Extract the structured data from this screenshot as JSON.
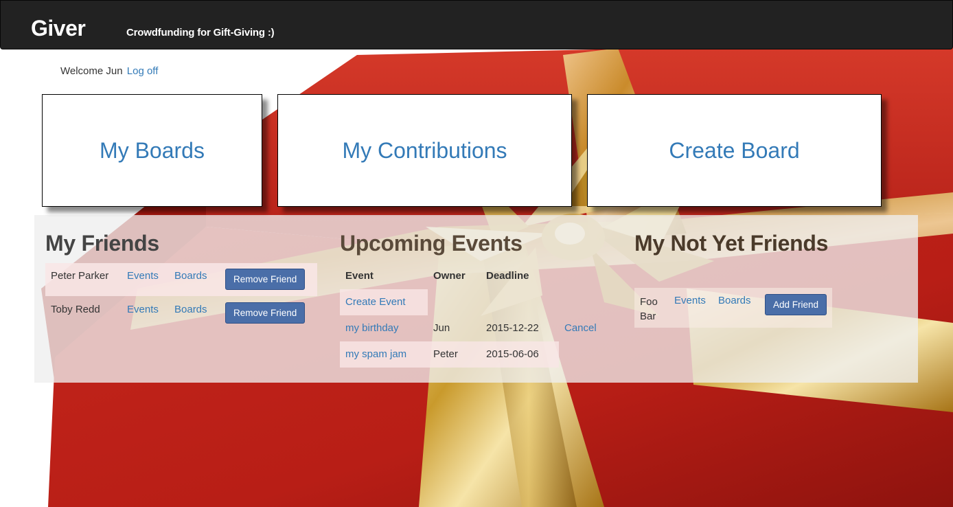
{
  "navbar": {
    "brand": "Giver",
    "tagline": "Crowdfunding for Gift-Giving :)"
  },
  "welcome": {
    "text": "Welcome Jun",
    "logoff_label": "Log off"
  },
  "tiles": {
    "my_boards": "My Boards",
    "my_contributions": "My Contributions",
    "create_board": "Create Board"
  },
  "friends": {
    "title": "My Friends",
    "rows": [
      {
        "name": "Peter Parker",
        "events": "Events",
        "boards": "Boards",
        "action": "Remove Friend"
      },
      {
        "name": "Toby Redd",
        "events": "Events",
        "boards": "Boards",
        "action": "Remove Friend"
      }
    ]
  },
  "events": {
    "title": "Upcoming Events",
    "headers": {
      "event": "Event",
      "owner": "Owner",
      "deadline": "Deadline"
    },
    "create_label": "Create Event",
    "rows": [
      {
        "event": "my birthday",
        "owner": "Jun",
        "deadline": "2015-12-22",
        "action": "Cancel"
      },
      {
        "event": "my spam jam",
        "owner": "Peter",
        "deadline": "2015-06-06",
        "action": ""
      }
    ]
  },
  "not_yet_friends": {
    "title": "My Not Yet Friends",
    "rows": [
      {
        "name": "Foo Bar",
        "events": "Events",
        "boards": "Boards",
        "action": "Add Friend"
      }
    ]
  },
  "colors": {
    "navbar_bg": "#222222",
    "link": "#337ab7",
    "button": "#4a6ea8",
    "gift_red": "#c8251b",
    "ribbon_gold": "#d9b14a"
  }
}
